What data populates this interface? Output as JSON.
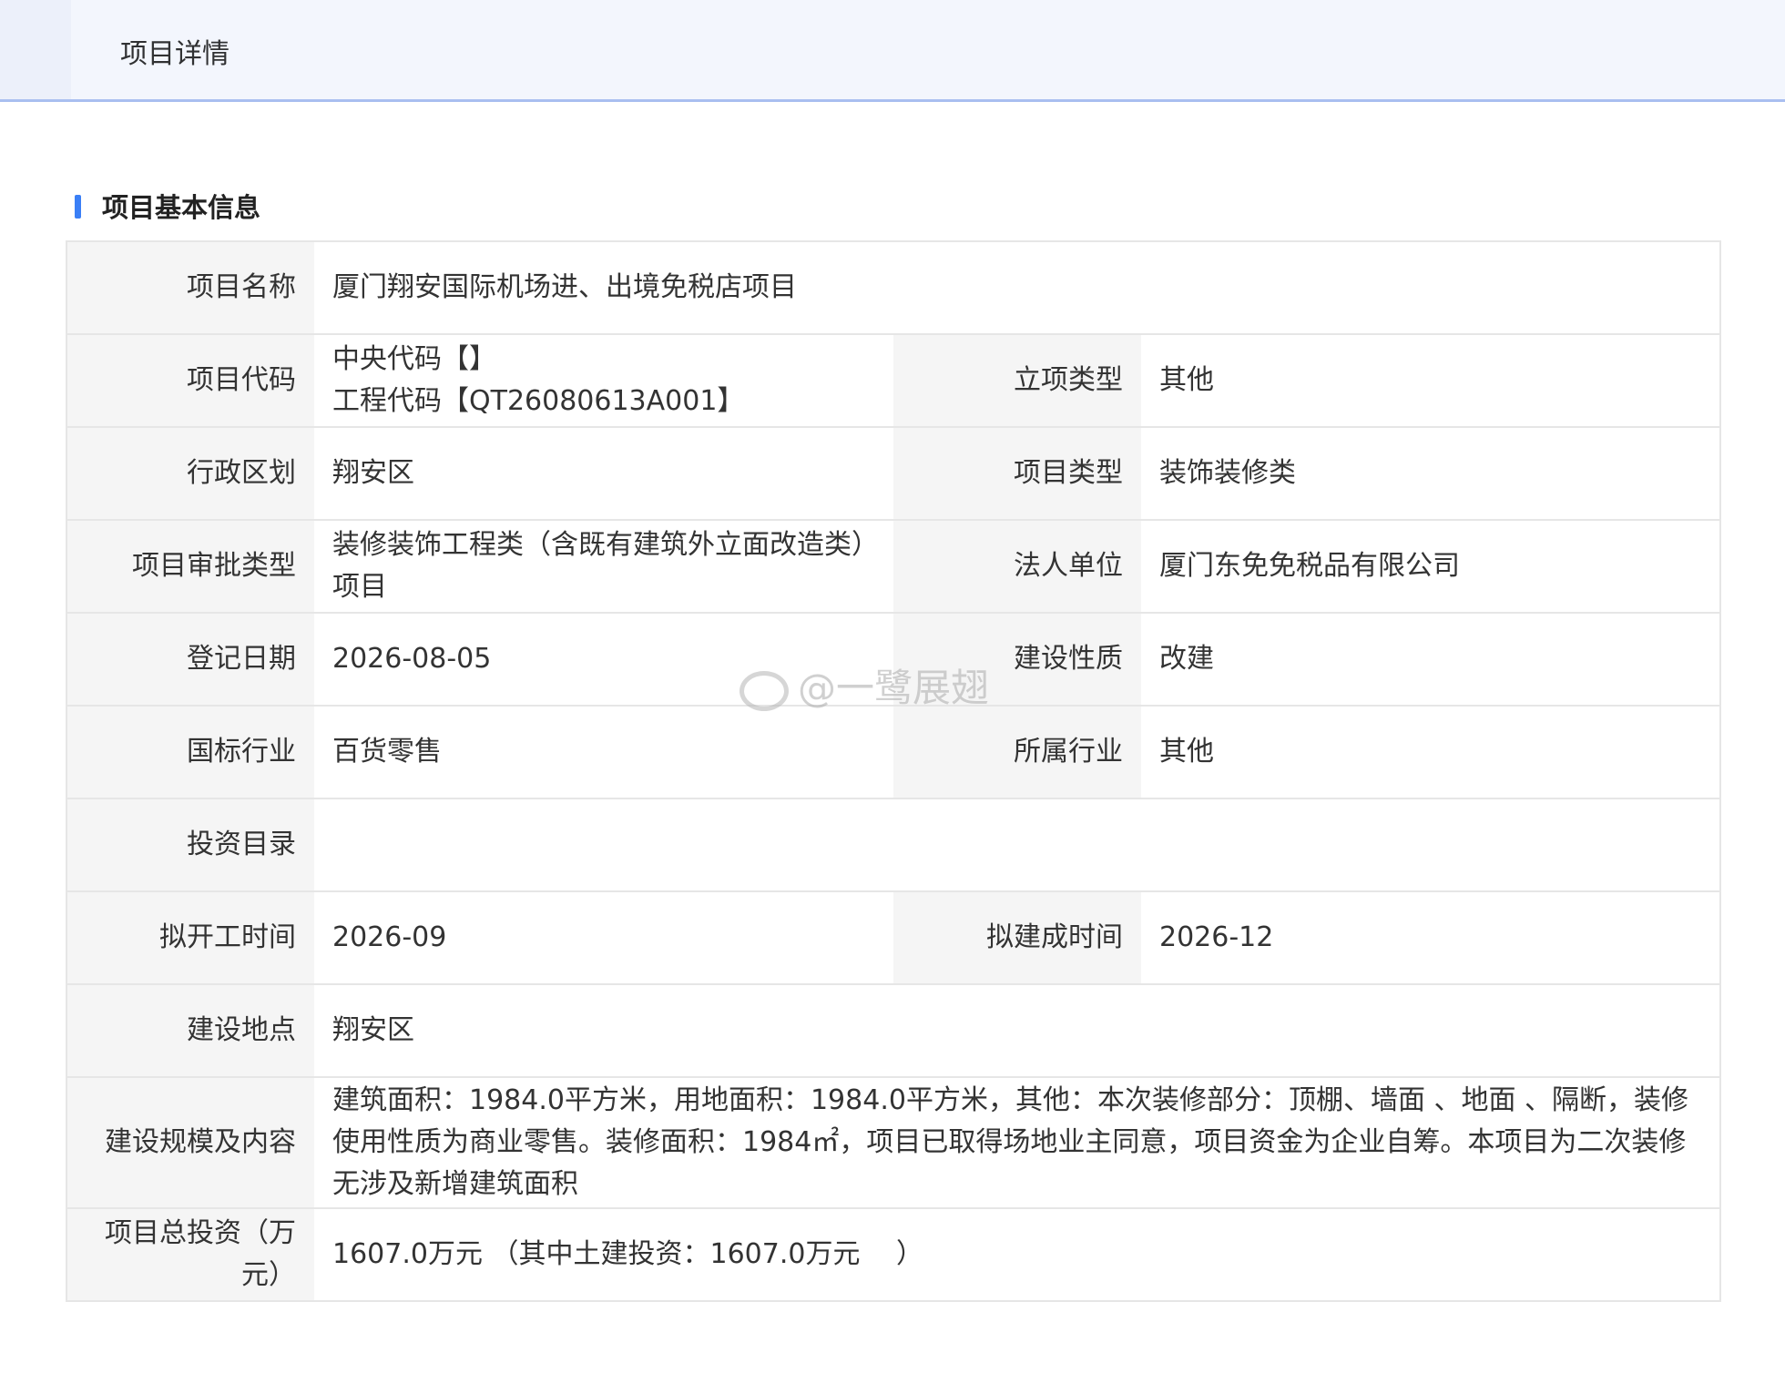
{
  "header": {
    "tab_title": "项目详情"
  },
  "section": {
    "title": "项目基本信息"
  },
  "rows": {
    "name": {
      "label": "项目名称",
      "value": "厦门翔安国际机场进、出境免税店项目"
    },
    "code": {
      "label": "项目代码",
      "value_line1": "中央代码【】",
      "value_line2": "工程代码【QT26080613A001】",
      "label2": "立项类型",
      "value2": "其他"
    },
    "region": {
      "label": "行政区划",
      "value": "翔安区",
      "label2": "项目类型",
      "value2": "装饰装修类"
    },
    "approval": {
      "label": "项目审批类型",
      "value": "装修装饰工程类（含既有建筑外立面改造类）项目",
      "label2": "法人单位",
      "value2": "厦门东免免税品有限公司"
    },
    "reg_date": {
      "label": "登记日期",
      "value": "2026-08-05",
      "label2": "建设性质",
      "value2": "改建"
    },
    "industry": {
      "label": "国标行业",
      "value": "百货零售",
      "label2": "所属行业",
      "value2": "其他"
    },
    "catalog": {
      "label": "投资目录",
      "value": ""
    },
    "schedule": {
      "label": "拟开工时间",
      "value": "2026-09",
      "label2": "拟建成时间",
      "value2": "2026-12"
    },
    "location": {
      "label": "建设地点",
      "value": "翔安区"
    },
    "scale": {
      "label": "建设规模及内容",
      "value": "建筑面积：1984.0平方米，用地面积：1984.0平方米，其他：本次装修部分：顶棚、墙面 、地面 、隔断，装修使用性质为商业零售。装修面积：1984㎡，项目已取得场地业主同意，项目资金为企业自筹。本项目为二次装修无涉及新增建筑面积"
    },
    "investment": {
      "label": "项目总投资（万元）",
      "value": "1607.0万元 （其中土建投资：1607.0万元　 ）"
    }
  },
  "watermark": {
    "text": "@一鹭展翅"
  }
}
